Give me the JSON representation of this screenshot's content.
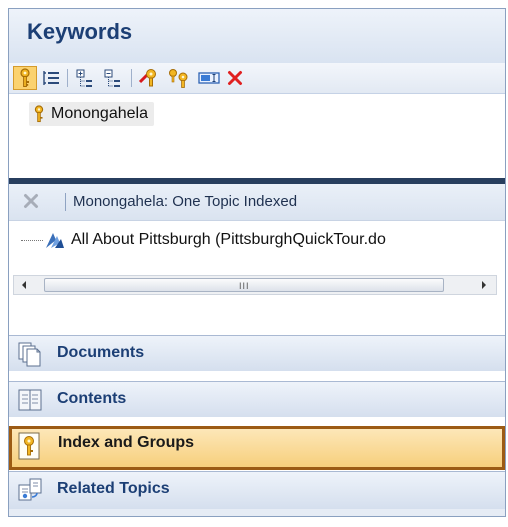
{
  "header": {
    "title": "Keywords"
  },
  "toolbar": {
    "buttons": [
      {
        "name": "keyword-icon",
        "active": true
      },
      {
        "name": "list-view-icon"
      },
      {
        "name": "expand-tree-icon"
      },
      {
        "name": "collapse-tree-icon"
      },
      {
        "name": "add-keyword-icon"
      },
      {
        "name": "add-subkeyword-icon"
      },
      {
        "name": "rename-icon"
      },
      {
        "name": "delete-icon"
      }
    ]
  },
  "keywords": {
    "items": [
      {
        "label": "Monongahela"
      }
    ]
  },
  "topics": {
    "caption": "Monongahela: One Topic Indexed",
    "items": [
      {
        "label": "All About Pittsburgh (PittsburghQuickTour.do"
      }
    ],
    "scroll_grip": "III"
  },
  "nav": {
    "documents": "Documents",
    "contents": "Contents",
    "index_groups": "Index and Groups",
    "related": "Related Topics",
    "selected": "Index and Groups"
  },
  "colors": {
    "accent_text": "#1c3f75",
    "selected_bg": "#f7cf7c",
    "selected_border": "#9c5b14",
    "delete_red": "#e02020"
  }
}
